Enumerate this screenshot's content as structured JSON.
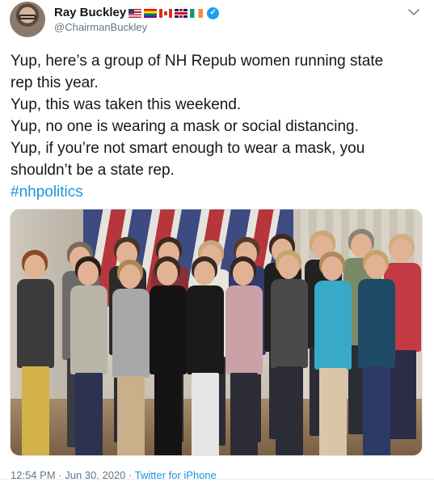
{
  "author": {
    "name": "Ray Buckley",
    "handle": "@ChairmanBuckley"
  },
  "tweet": {
    "lines": [
      "Yup, here’s a group of NH Repub women running state",
      "rep this year.",
      "Yup, this was taken this weekend.",
      "Yup, no one is wearing a mask or social distancing.",
      "Yup, if you’re not smart enough to wear a mask, you",
      "shouldn’t be a state rep."
    ],
    "hashtag": "#nhpolitics"
  },
  "meta": {
    "time": "12:54 PM",
    "separator1": " · ",
    "date": "Jun 30, 2020",
    "separator2": " · ",
    "source": "Twitter for iPhone"
  },
  "icons": {
    "verified": "verified-badge-icon",
    "menu": "chevron-down-icon",
    "flags": [
      "us-flag",
      "rainbow-flag",
      "canada-flag",
      "uk-flag",
      "ireland-flag"
    ]
  },
  "colors": {
    "link": "#1b95e0",
    "verified": "#1da1f2",
    "secondary_text": "#657786",
    "primary_text": "#14171a"
  }
}
